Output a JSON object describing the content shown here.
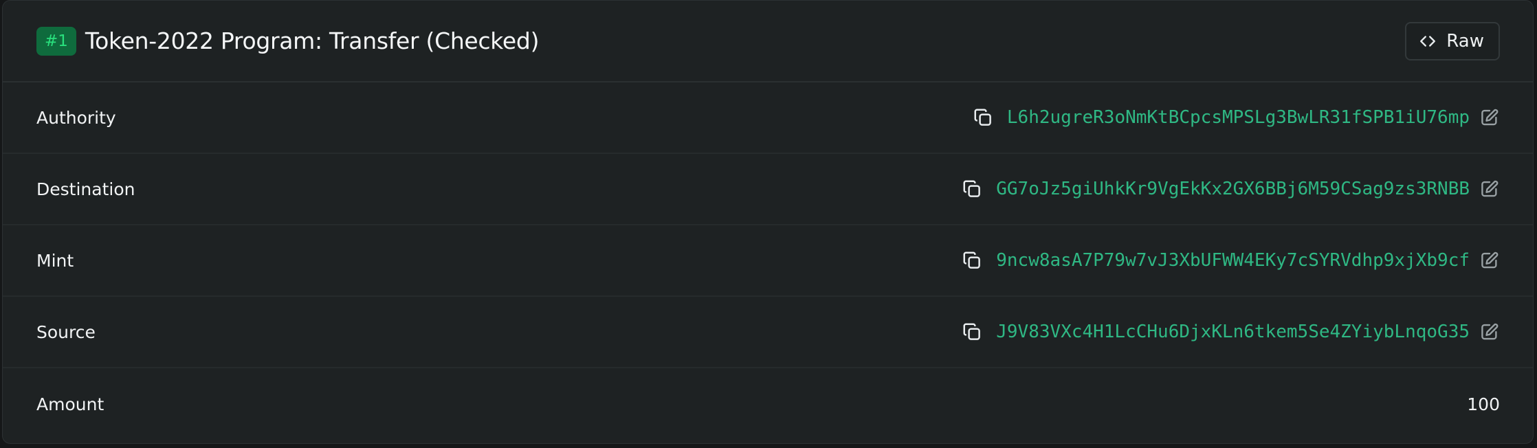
{
  "instruction": {
    "badge": "#1",
    "title": "Token-2022 Program: Transfer (Checked)",
    "raw_label": "Raw"
  },
  "accounts": [
    {
      "label": "Authority",
      "address": "L6h2ugreR3oNmKtBCpcsMPSLg3BwLR31fSPB1iU76mp"
    },
    {
      "label": "Destination",
      "address": "GG7oJz5giUhkKr9VgEkKx2GX6BBj6M59CSag9zs3RNBB"
    },
    {
      "label": "Mint",
      "address": "9ncw8asA7P79w7vJ3XbUFWW4EKy7cSYRVdhp9xjXb9cf"
    },
    {
      "label": "Source",
      "address": "J9V83VXc4H1LcCHu6DjxKLn6tkem5Se4ZYiybLnqoG35"
    }
  ],
  "amount": {
    "label": "Amount",
    "value": "100"
  },
  "icons": {
    "copy": "copy-icon",
    "edit": "edit-icon",
    "code": "code-icon"
  },
  "colors": {
    "background": "#1e2223",
    "address": "#2fb884",
    "badge_bg": "#0f6b3d",
    "badge_text": "#29e07d"
  }
}
